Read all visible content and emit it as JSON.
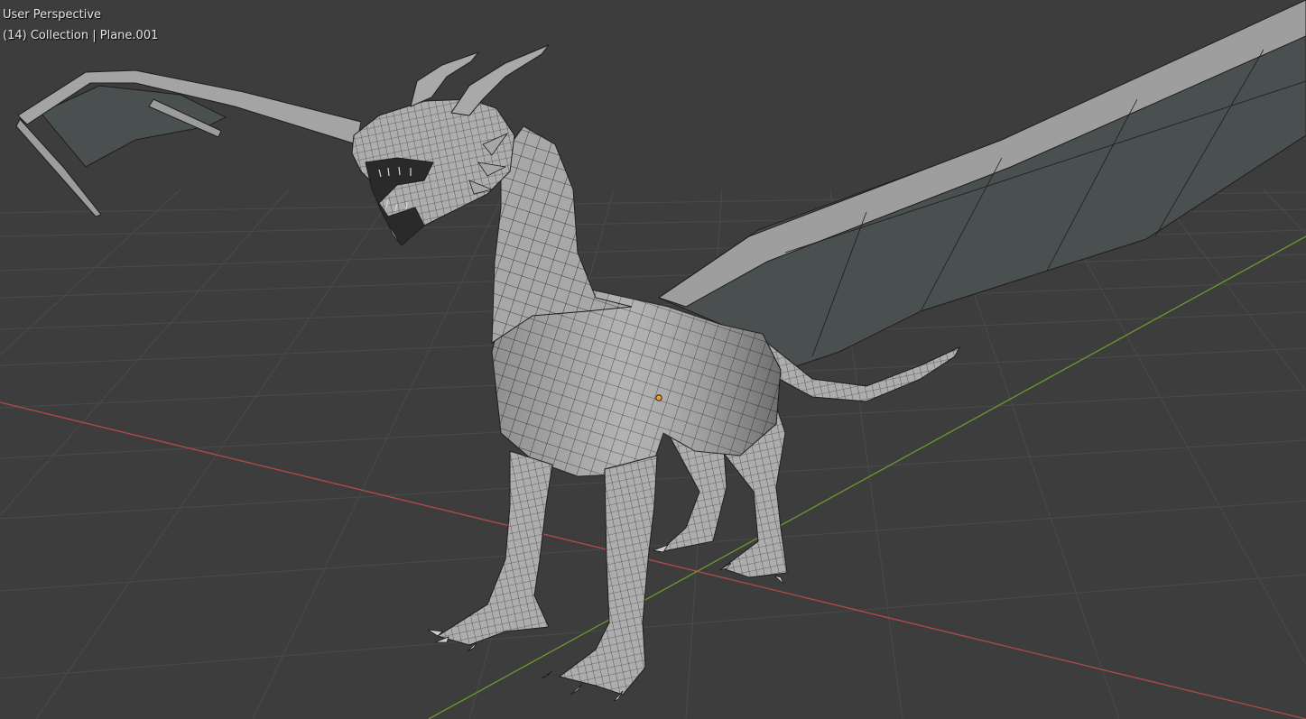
{
  "viewport": {
    "view_name": "User Perspective",
    "object_info": "(14) Collection | Plane.001"
  },
  "colors": {
    "background": "#3d3d3d",
    "grid_line": "#4a4a4a",
    "x_axis": "#b34a4a",
    "y_axis": "#6a9a2e",
    "mesh_fill": "#a9a9a9",
    "mesh_wire": "#1e1e1e",
    "wing_membrane": "#4b4f4f",
    "origin_point": "#f29b2a"
  },
  "scene": {
    "object_icon": "dragon-mesh",
    "origin_icon": "object-origin-dot"
  }
}
